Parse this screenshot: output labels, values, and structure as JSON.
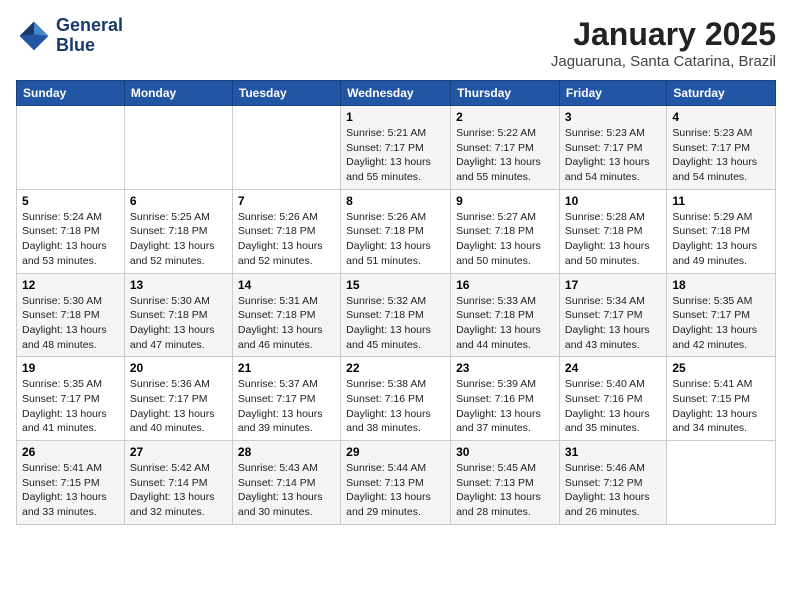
{
  "logo": {
    "line1": "General",
    "line2": "Blue"
  },
  "title": "January 2025",
  "location": "Jaguaruna, Santa Catarina, Brazil",
  "weekdays": [
    "Sunday",
    "Monday",
    "Tuesday",
    "Wednesday",
    "Thursday",
    "Friday",
    "Saturday"
  ],
  "weeks": [
    [
      {
        "day": "",
        "info": ""
      },
      {
        "day": "",
        "info": ""
      },
      {
        "day": "",
        "info": ""
      },
      {
        "day": "1",
        "info": "Sunrise: 5:21 AM\nSunset: 7:17 PM\nDaylight: 13 hours\nand 55 minutes."
      },
      {
        "day": "2",
        "info": "Sunrise: 5:22 AM\nSunset: 7:17 PM\nDaylight: 13 hours\nand 55 minutes."
      },
      {
        "day": "3",
        "info": "Sunrise: 5:23 AM\nSunset: 7:17 PM\nDaylight: 13 hours\nand 54 minutes."
      },
      {
        "day": "4",
        "info": "Sunrise: 5:23 AM\nSunset: 7:17 PM\nDaylight: 13 hours\nand 54 minutes."
      }
    ],
    [
      {
        "day": "5",
        "info": "Sunrise: 5:24 AM\nSunset: 7:18 PM\nDaylight: 13 hours\nand 53 minutes."
      },
      {
        "day": "6",
        "info": "Sunrise: 5:25 AM\nSunset: 7:18 PM\nDaylight: 13 hours\nand 52 minutes."
      },
      {
        "day": "7",
        "info": "Sunrise: 5:26 AM\nSunset: 7:18 PM\nDaylight: 13 hours\nand 52 minutes."
      },
      {
        "day": "8",
        "info": "Sunrise: 5:26 AM\nSunset: 7:18 PM\nDaylight: 13 hours\nand 51 minutes."
      },
      {
        "day": "9",
        "info": "Sunrise: 5:27 AM\nSunset: 7:18 PM\nDaylight: 13 hours\nand 50 minutes."
      },
      {
        "day": "10",
        "info": "Sunrise: 5:28 AM\nSunset: 7:18 PM\nDaylight: 13 hours\nand 50 minutes."
      },
      {
        "day": "11",
        "info": "Sunrise: 5:29 AM\nSunset: 7:18 PM\nDaylight: 13 hours\nand 49 minutes."
      }
    ],
    [
      {
        "day": "12",
        "info": "Sunrise: 5:30 AM\nSunset: 7:18 PM\nDaylight: 13 hours\nand 48 minutes."
      },
      {
        "day": "13",
        "info": "Sunrise: 5:30 AM\nSunset: 7:18 PM\nDaylight: 13 hours\nand 47 minutes."
      },
      {
        "day": "14",
        "info": "Sunrise: 5:31 AM\nSunset: 7:18 PM\nDaylight: 13 hours\nand 46 minutes."
      },
      {
        "day": "15",
        "info": "Sunrise: 5:32 AM\nSunset: 7:18 PM\nDaylight: 13 hours\nand 45 minutes."
      },
      {
        "day": "16",
        "info": "Sunrise: 5:33 AM\nSunset: 7:18 PM\nDaylight: 13 hours\nand 44 minutes."
      },
      {
        "day": "17",
        "info": "Sunrise: 5:34 AM\nSunset: 7:17 PM\nDaylight: 13 hours\nand 43 minutes."
      },
      {
        "day": "18",
        "info": "Sunrise: 5:35 AM\nSunset: 7:17 PM\nDaylight: 13 hours\nand 42 minutes."
      }
    ],
    [
      {
        "day": "19",
        "info": "Sunrise: 5:35 AM\nSunset: 7:17 PM\nDaylight: 13 hours\nand 41 minutes."
      },
      {
        "day": "20",
        "info": "Sunrise: 5:36 AM\nSunset: 7:17 PM\nDaylight: 13 hours\nand 40 minutes."
      },
      {
        "day": "21",
        "info": "Sunrise: 5:37 AM\nSunset: 7:17 PM\nDaylight: 13 hours\nand 39 minutes."
      },
      {
        "day": "22",
        "info": "Sunrise: 5:38 AM\nSunset: 7:16 PM\nDaylight: 13 hours\nand 38 minutes."
      },
      {
        "day": "23",
        "info": "Sunrise: 5:39 AM\nSunset: 7:16 PM\nDaylight: 13 hours\nand 37 minutes."
      },
      {
        "day": "24",
        "info": "Sunrise: 5:40 AM\nSunset: 7:16 PM\nDaylight: 13 hours\nand 35 minutes."
      },
      {
        "day": "25",
        "info": "Sunrise: 5:41 AM\nSunset: 7:15 PM\nDaylight: 13 hours\nand 34 minutes."
      }
    ],
    [
      {
        "day": "26",
        "info": "Sunrise: 5:41 AM\nSunset: 7:15 PM\nDaylight: 13 hours\nand 33 minutes."
      },
      {
        "day": "27",
        "info": "Sunrise: 5:42 AM\nSunset: 7:14 PM\nDaylight: 13 hours\nand 32 minutes."
      },
      {
        "day": "28",
        "info": "Sunrise: 5:43 AM\nSunset: 7:14 PM\nDaylight: 13 hours\nand 30 minutes."
      },
      {
        "day": "29",
        "info": "Sunrise: 5:44 AM\nSunset: 7:13 PM\nDaylight: 13 hours\nand 29 minutes."
      },
      {
        "day": "30",
        "info": "Sunrise: 5:45 AM\nSunset: 7:13 PM\nDaylight: 13 hours\nand 28 minutes."
      },
      {
        "day": "31",
        "info": "Sunrise: 5:46 AM\nSunset: 7:12 PM\nDaylight: 13 hours\nand 26 minutes."
      },
      {
        "day": "",
        "info": ""
      }
    ]
  ]
}
